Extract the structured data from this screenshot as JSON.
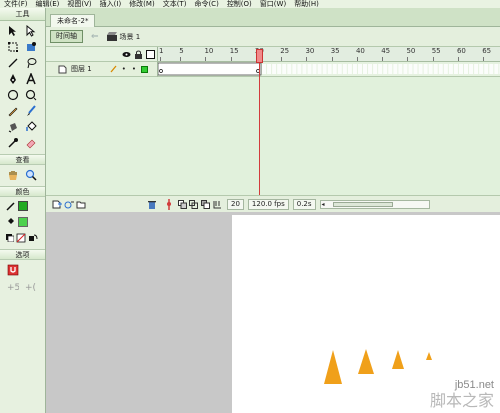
{
  "menu": {
    "items": [
      "文件(F)",
      "编辑(E)",
      "视图(V)",
      "插入(I)",
      "修改(M)",
      "文本(T)",
      "命令(C)",
      "控制(O)",
      "窗口(W)",
      "帮助(H)"
    ]
  },
  "tools_panel": {
    "title": "工具",
    "view_label": "查看",
    "colors_label": "颜色",
    "options_label": "选项"
  },
  "document": {
    "tab_label": "未命名-2*"
  },
  "edit_bar": {
    "timeline_button": "时间轴",
    "scene_label": "场景 1"
  },
  "timeline": {
    "ruler_numbers": [
      "1",
      "5",
      "10",
      "15",
      "20",
      "25",
      "30",
      "35",
      "40",
      "45",
      "50",
      "55",
      "60",
      "65"
    ],
    "layer_name": "图层 1",
    "current_frame": "20",
    "fps": "120.0 fps",
    "elapsed": "0.2s"
  },
  "colors": {
    "stroke": "#22aa22",
    "fill": "#4dd14d",
    "accent_bg": "#e5f2e0",
    "playhead": "#d23c3c",
    "tree": "#f0a01a"
  },
  "watermark": {
    "line1": "jb51.net",
    "line2": "脚本之家"
  }
}
